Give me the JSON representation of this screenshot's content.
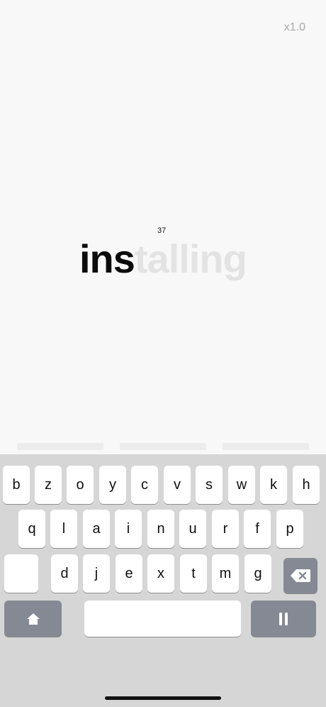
{
  "header": {
    "speed_label": "x1.0"
  },
  "word": {
    "counter": "37",
    "typed": "ins",
    "remaining": "talling"
  },
  "keyboard": {
    "rows": [
      [
        "b",
        "z",
        "o",
        "y",
        "c",
        "v",
        "s",
        "w",
        "k",
        "h"
      ],
      [
        "q",
        "l",
        "a",
        "i",
        "n",
        "u",
        "r",
        "f",
        "p"
      ],
      [
        "d",
        "j",
        "e",
        "x",
        "t",
        "m",
        "g"
      ]
    ],
    "backspace_icon": "backspace-icon",
    "shift_icon": "home-icon",
    "pause_icon": "pause-icon"
  }
}
